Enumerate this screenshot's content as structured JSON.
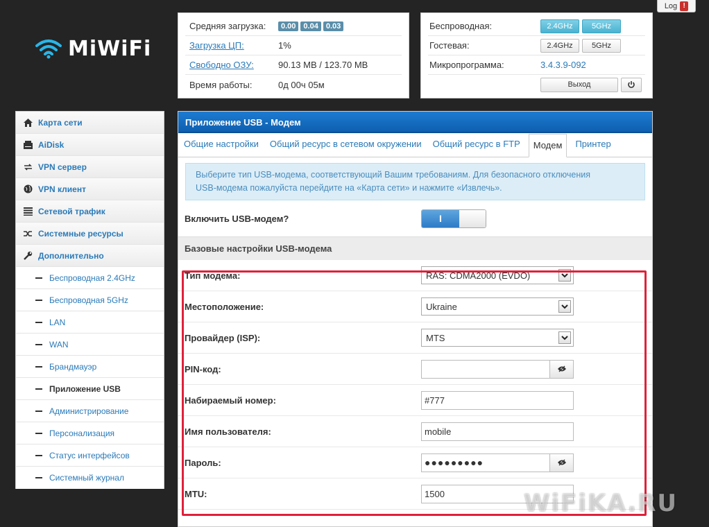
{
  "logo": {
    "text": "MiWiFi"
  },
  "logout": {
    "label": "Log",
    "badge": "!"
  },
  "status": {
    "load_label": "Средняя загрузка:",
    "load_values": [
      "0.00",
      "0.04",
      "0.03"
    ],
    "cpu_label": "Загрузка ЦП:",
    "cpu_value": "1%",
    "ram_label": "Свободно ОЗУ:",
    "ram_value": "90.13 MB / 123.70 MB",
    "uptime_label": "Время работы:",
    "uptime_value": "0д 00ч 05м"
  },
  "wireless": {
    "wireless_label": "Беспроводная:",
    "guest_label": "Гостевая:",
    "firmware_label": "Микропрограмма:",
    "firmware_value": "3.4.3.9-092",
    "band_24": "2.4GHz",
    "band_5": "5GHz",
    "exit_label": "Выход"
  },
  "sidebar": {
    "items": [
      {
        "label": "Карта сети",
        "icon": "home-icon"
      },
      {
        "label": "AiDisk",
        "icon": "disk-icon"
      },
      {
        "label": "VPN сервер",
        "icon": "vpn-server-icon"
      },
      {
        "label": "VPN клиент",
        "icon": "globe-icon"
      },
      {
        "label": "Сетевой трафик",
        "icon": "traffic-icon"
      },
      {
        "label": "Системные ресурсы",
        "icon": "shuffle-icon"
      },
      {
        "label": "Дополнительно",
        "icon": "wrench-icon"
      }
    ],
    "sub": [
      "Беспроводная 2.4GHz",
      "Беспроводная 5GHz",
      "LAN",
      "WAN",
      "Брандмауэр",
      "Приложение USB",
      "Администрирование",
      "Персонализация",
      "Статус интерфейсов",
      "Системный журнал"
    ]
  },
  "main": {
    "title": "Приложение USB - Модем",
    "tabs": [
      "Общие настройки",
      "Общий ресурс в сетевом окружении",
      "Общий ресурс в FTP",
      "Модем",
      "Принтер"
    ],
    "alert_line1": "Выберите тип USB-модема, соответствующий Вашим требованиям. Для безопасного отключения",
    "alert_line2": "USB-модема пожалуйста перейдите на «Карта сети» и нажмите «Извлечь».",
    "enable_label": "Включить USB-модем?",
    "switch_on": "I",
    "section_title": "Базовые настройки USB-модема",
    "fields": {
      "modem_type_label": "Тип модема:",
      "modem_type_value": "RAS: CDMA2000 (EVDO)",
      "location_label": "Местоположение:",
      "location_value": "Ukraine",
      "isp_label": "Провайдер (ISP):",
      "isp_value": "MTS",
      "pin_label": "PIN-код:",
      "pin_value": "",
      "dial_label": "Набираемый номер:",
      "dial_value": "#777",
      "user_label": "Имя пользователя:",
      "user_value": "mobile",
      "password_label": "Пароль:",
      "password_value": "●●●●●●●●●",
      "mtu_label": "MTU:",
      "mtu_value": "1500"
    }
  },
  "watermark": "WiFiKA.RU",
  "colors": {
    "header_blue": "#0d5fb0",
    "link_blue": "#2a7ab8",
    "highlight_red": "#e0203a"
  }
}
